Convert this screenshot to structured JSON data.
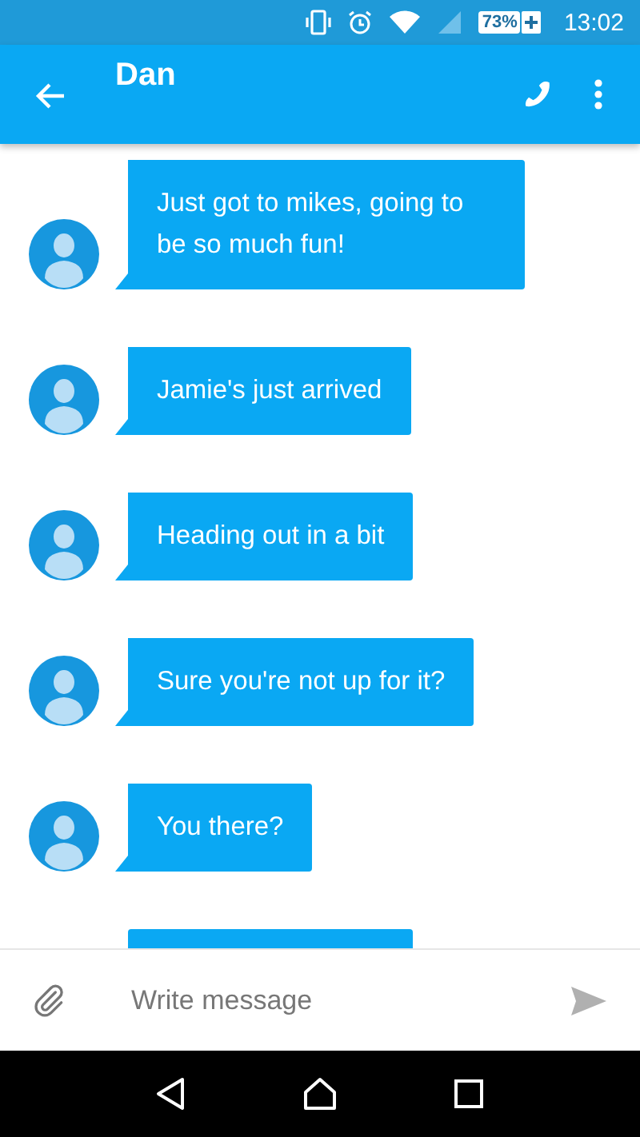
{
  "status_bar": {
    "battery": "73%",
    "time": "13:02"
  },
  "app_bar": {
    "title": "Dan"
  },
  "messages": [
    {
      "text": "Just got to mikes, going to be so much fun!"
    },
    {
      "text": "Jamie's just arrived"
    },
    {
      "text": "Heading out in a bit"
    },
    {
      "text": "Sure you're not up for it?"
    },
    {
      "text": "You there?"
    }
  ],
  "composer": {
    "placeholder": "Write message"
  }
}
